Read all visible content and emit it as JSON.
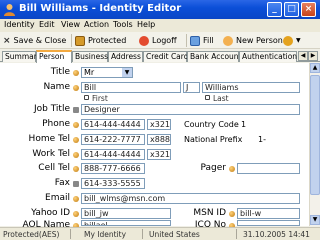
{
  "window": {
    "title": "Bill Williams - Identity Editor",
    "minimize": "_",
    "maximize": "□",
    "close": "×"
  },
  "menu": [
    "Identity",
    "Edit",
    "View",
    "Action",
    "Tools",
    "Help"
  ],
  "toolbar": {
    "close_symbol": "×",
    "save_close": "Save & Close",
    "protected": "Protected",
    "logoff": "Logoff",
    "fill": "Fill",
    "new_person": "New Person"
  },
  "tabs": [
    "Summary",
    "Person",
    "Business",
    "Address",
    "Credit Card",
    "Bank Account",
    "Authentication"
  ],
  "active_tab": "Person",
  "tab_scroll": {
    "left": "◀",
    "right": "▶"
  },
  "form": {
    "title_label": "Title",
    "title_value": "Mr",
    "select_arrow": "▼",
    "name_label": "Name",
    "first_name": "Bill",
    "middle_initial": "J",
    "last_name": "Williams",
    "first_caption": "First",
    "last_caption": "Last",
    "job_title_label": "Job Title",
    "job_title_value": "Designer",
    "phone_label": "Phone",
    "phone_value": "614-444-4444",
    "phone_ext": "x321",
    "country_code_label": "Country Code",
    "country_code_value": "1",
    "home_tel_label": "Home Tel",
    "home_tel_value": "614-222-7777",
    "home_tel_ext": "x888",
    "national_prefix_label": "National Prefix",
    "national_prefix_value": "1-",
    "work_tel_label": "Work Tel",
    "work_tel_value": "614-444-4444",
    "work_tel_ext": "x321",
    "cell_tel_label": "Cell Tel",
    "cell_tel_value": "888-777-6666",
    "pager_label": "Pager",
    "pager_value": "",
    "fax_label": "Fax",
    "fax_value": "614-333-5555",
    "email_label": "Email",
    "email_value": "bill_wlms@msn.com",
    "yahoo_label": "Yahoo ID",
    "yahoo_value": "bill_jw",
    "msn_label": "MSN ID",
    "msn_value": "bill-w",
    "aol_label": "AOL Name",
    "aol_value": "billaol",
    "icq_label": "ICQ No",
    "icq_value": ""
  },
  "scrollbar": {
    "up": "▲",
    "down": "▼"
  },
  "status": {
    "protection": "Protected(AES)",
    "identity": "My Identity",
    "country": "United States",
    "datetime": "31.10.2005 14:41"
  },
  "colors": {
    "titlebar": "#0b4fd8",
    "active_tab_accent": "#f3a940",
    "field_border": "#7f9db9"
  }
}
